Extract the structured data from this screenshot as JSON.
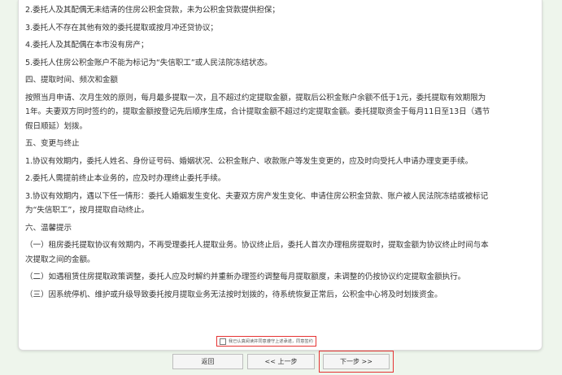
{
  "content": {
    "l1": "2.委托人及其配偶无未结清的住房公积金贷款，未为公积金贷款提供担保；",
    "l2": "3.委托人不存在其他有效的委托提取或按月冲还贷协议；",
    "l3": "4.委托人及其配偶在本市没有房产；",
    "l4": "5.委托人住房公积金账户不能为标记为“失信职工”或人民法院冻结状态。",
    "h4": "四、提取时间、频次和金额",
    "p4a": "按照当月申请、次月生效的原则，每月最多提取一次，且不超过约定提取金额，提取后公积金账户余额不低于1元，委托提取有效期限为",
    "p4b": "1年。夫妻双方同时签约的，提取金额按登记先后顺序生成，合计提取金额不超过约定提取金额。委托提取资金于每月11日至13日（遇节",
    "p4c": "假日顺延）划拨。",
    "h5": "五、变更与终止",
    "p5a": "1.协议有效期内，委托人姓名、身份证号码、婚姻状况、公积金账户、收款账户等发生变更的，应及时向受托人申请办理变更手续。",
    "p5b": "2.委托人需提前终止本业务的，应及时办理终止委托手续。",
    "p5c1": "3.协议有效期内，遇以下任一情形：委托人婚姻发生变化、夫妻双方房产发生变化、申请住房公积金贷款、账户被人民法院冻结或被标记",
    "p5c2": "为“失信职工”，按月提取自动终止。",
    "h6": "六、温馨提示",
    "p6a1": "（一）租房委托提取协议有效期内，不再受理委托人提取业务。协议终止后，委托人首次办理租房提取时，提取金额为协议终止时间与本",
    "p6a2": "次提取之间的金额。",
    "p6b": "（二）如遇租赁住房提取政策调整，委托人应及时解约并重新办理签约调整每月提取额度，未调整的仍按协议约定提取金额执行。",
    "p6c": "（三）因系统停机、维护或升级导致委托按月提取业务无法按时划拨的，待系统恢复正常后，公积金中心将及时划拨资金。"
  },
  "agreement": {
    "label": "我已认真阅读并同意遵守上述承诺，同意签约"
  },
  "buttons": {
    "back": "返回",
    "prev": "<< 上一步",
    "next": "下一步 >>"
  },
  "colors": {
    "highlight": "#e53333",
    "page_bg": "#eef5ec"
  }
}
